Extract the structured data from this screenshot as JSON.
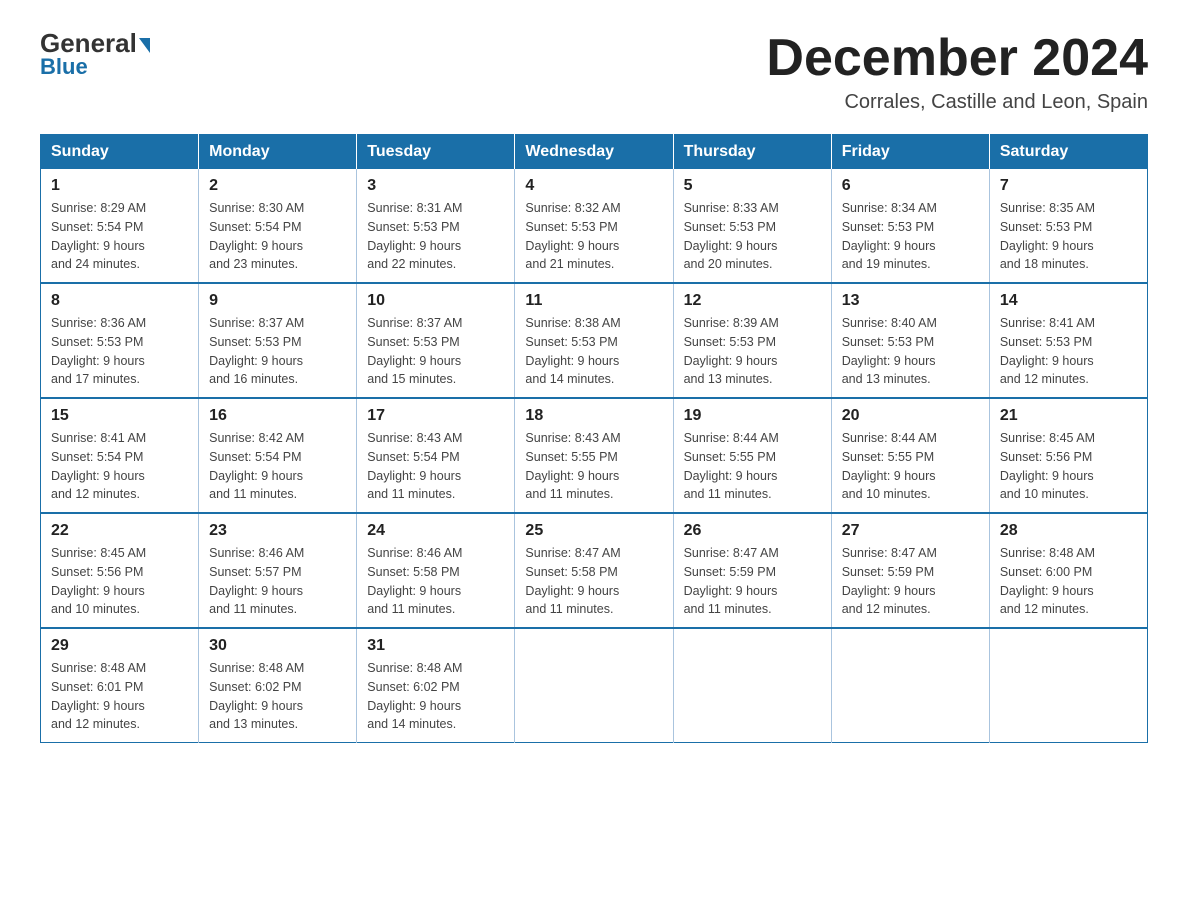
{
  "header": {
    "logo_general": "General",
    "logo_blue": "Blue",
    "month_title": "December 2024",
    "subtitle": "Corrales, Castille and Leon, Spain"
  },
  "weekdays": [
    "Sunday",
    "Monday",
    "Tuesday",
    "Wednesday",
    "Thursday",
    "Friday",
    "Saturday"
  ],
  "weeks": [
    [
      {
        "day": "1",
        "sunrise": "8:29 AM",
        "sunset": "5:54 PM",
        "daylight": "9 hours and 24 minutes."
      },
      {
        "day": "2",
        "sunrise": "8:30 AM",
        "sunset": "5:54 PM",
        "daylight": "9 hours and 23 minutes."
      },
      {
        "day": "3",
        "sunrise": "8:31 AM",
        "sunset": "5:53 PM",
        "daylight": "9 hours and 22 minutes."
      },
      {
        "day": "4",
        "sunrise": "8:32 AM",
        "sunset": "5:53 PM",
        "daylight": "9 hours and 21 minutes."
      },
      {
        "day": "5",
        "sunrise": "8:33 AM",
        "sunset": "5:53 PM",
        "daylight": "9 hours and 20 minutes."
      },
      {
        "day": "6",
        "sunrise": "8:34 AM",
        "sunset": "5:53 PM",
        "daylight": "9 hours and 19 minutes."
      },
      {
        "day": "7",
        "sunrise": "8:35 AM",
        "sunset": "5:53 PM",
        "daylight": "9 hours and 18 minutes."
      }
    ],
    [
      {
        "day": "8",
        "sunrise": "8:36 AM",
        "sunset": "5:53 PM",
        "daylight": "9 hours and 17 minutes."
      },
      {
        "day": "9",
        "sunrise": "8:37 AM",
        "sunset": "5:53 PM",
        "daylight": "9 hours and 16 minutes."
      },
      {
        "day": "10",
        "sunrise": "8:37 AM",
        "sunset": "5:53 PM",
        "daylight": "9 hours and 15 minutes."
      },
      {
        "day": "11",
        "sunrise": "8:38 AM",
        "sunset": "5:53 PM",
        "daylight": "9 hours and 14 minutes."
      },
      {
        "day": "12",
        "sunrise": "8:39 AM",
        "sunset": "5:53 PM",
        "daylight": "9 hours and 13 minutes."
      },
      {
        "day": "13",
        "sunrise": "8:40 AM",
        "sunset": "5:53 PM",
        "daylight": "9 hours and 13 minutes."
      },
      {
        "day": "14",
        "sunrise": "8:41 AM",
        "sunset": "5:53 PM",
        "daylight": "9 hours and 12 minutes."
      }
    ],
    [
      {
        "day": "15",
        "sunrise": "8:41 AM",
        "sunset": "5:54 PM",
        "daylight": "9 hours and 12 minutes."
      },
      {
        "day": "16",
        "sunrise": "8:42 AM",
        "sunset": "5:54 PM",
        "daylight": "9 hours and 11 minutes."
      },
      {
        "day": "17",
        "sunrise": "8:43 AM",
        "sunset": "5:54 PM",
        "daylight": "9 hours and 11 minutes."
      },
      {
        "day": "18",
        "sunrise": "8:43 AM",
        "sunset": "5:55 PM",
        "daylight": "9 hours and 11 minutes."
      },
      {
        "day": "19",
        "sunrise": "8:44 AM",
        "sunset": "5:55 PM",
        "daylight": "9 hours and 11 minutes."
      },
      {
        "day": "20",
        "sunrise": "8:44 AM",
        "sunset": "5:55 PM",
        "daylight": "9 hours and 10 minutes."
      },
      {
        "day": "21",
        "sunrise": "8:45 AM",
        "sunset": "5:56 PM",
        "daylight": "9 hours and 10 minutes."
      }
    ],
    [
      {
        "day": "22",
        "sunrise": "8:45 AM",
        "sunset": "5:56 PM",
        "daylight": "9 hours and 10 minutes."
      },
      {
        "day": "23",
        "sunrise": "8:46 AM",
        "sunset": "5:57 PM",
        "daylight": "9 hours and 11 minutes."
      },
      {
        "day": "24",
        "sunrise": "8:46 AM",
        "sunset": "5:58 PM",
        "daylight": "9 hours and 11 minutes."
      },
      {
        "day": "25",
        "sunrise": "8:47 AM",
        "sunset": "5:58 PM",
        "daylight": "9 hours and 11 minutes."
      },
      {
        "day": "26",
        "sunrise": "8:47 AM",
        "sunset": "5:59 PM",
        "daylight": "9 hours and 11 minutes."
      },
      {
        "day": "27",
        "sunrise": "8:47 AM",
        "sunset": "5:59 PM",
        "daylight": "9 hours and 12 minutes."
      },
      {
        "day": "28",
        "sunrise": "8:48 AM",
        "sunset": "6:00 PM",
        "daylight": "9 hours and 12 minutes."
      }
    ],
    [
      {
        "day": "29",
        "sunrise": "8:48 AM",
        "sunset": "6:01 PM",
        "daylight": "9 hours and 12 minutes."
      },
      {
        "day": "30",
        "sunrise": "8:48 AM",
        "sunset": "6:02 PM",
        "daylight": "9 hours and 13 minutes."
      },
      {
        "day": "31",
        "sunrise": "8:48 AM",
        "sunset": "6:02 PM",
        "daylight": "9 hours and 14 minutes."
      },
      null,
      null,
      null,
      null
    ]
  ],
  "labels": {
    "sunrise": "Sunrise:",
    "sunset": "Sunset:",
    "daylight": "Daylight:"
  }
}
